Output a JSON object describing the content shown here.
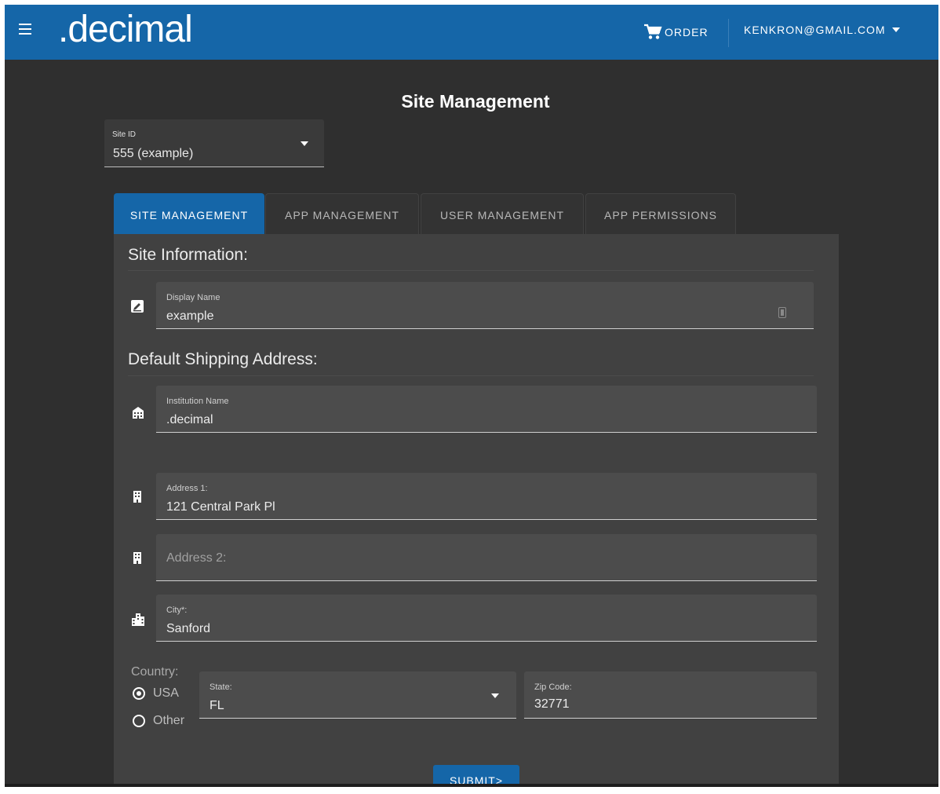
{
  "app": {
    "logo": ".decimal",
    "order_label": "ORDER",
    "account_email": "KENKRON@GMAIL.COM"
  },
  "page": {
    "title": "Site Management"
  },
  "site_selector": {
    "label": "Site ID",
    "value": "555 (example)"
  },
  "tabs": [
    {
      "label": "SITE MANAGEMENT",
      "active": true
    },
    {
      "label": "APP MANAGEMENT",
      "active": false
    },
    {
      "label": "USER MANAGEMENT",
      "active": false
    },
    {
      "label": "APP PERMISSIONS",
      "active": false
    }
  ],
  "site_info": {
    "heading": "Site Information:",
    "display_name": {
      "label": "Display Name",
      "value": "example"
    }
  },
  "shipping": {
    "heading": "Default Shipping Address:",
    "institution": {
      "label": "Institution Name",
      "value": ".decimal"
    },
    "address1": {
      "label": "Address 1:",
      "value": "121 Central Park Pl"
    },
    "address2": {
      "placeholder": "Address 2:"
    },
    "city": {
      "label": "City*:",
      "value": "Sanford"
    },
    "country": {
      "label": "Country:",
      "options": [
        {
          "label": "USA",
          "selected": true
        },
        {
          "label": "Other",
          "selected": false
        }
      ]
    },
    "state": {
      "label": "State:",
      "value": "FL"
    },
    "zip": {
      "label": "Zip Code:",
      "value": "32771"
    }
  },
  "submit_label": "SUBMIT>",
  "colors": {
    "brand": "#1566a8",
    "background": "#2f2f2f",
    "panel": "#414141",
    "field": "#4c4c4c"
  }
}
